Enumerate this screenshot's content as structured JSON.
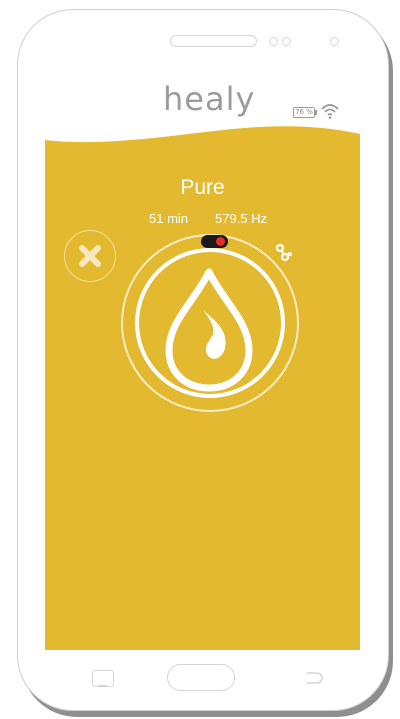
{
  "app": {
    "logo_text": "healy",
    "battery_text": "76 %",
    "icons": [
      "battery-icon",
      "wifi-icon",
      "close-icon",
      "link-icon",
      "water-drop-icon"
    ]
  },
  "program": {
    "name": "Pure",
    "duration": "51 min",
    "frequency": "579.5 Hz"
  },
  "colors": {
    "background": "#e3b930",
    "header": "#ffffff",
    "accent_toggle_on": "#e52b2b",
    "text": "#ffffff"
  },
  "system_nav": [
    "recent-apps-icon",
    "home-button",
    "back-icon"
  ]
}
